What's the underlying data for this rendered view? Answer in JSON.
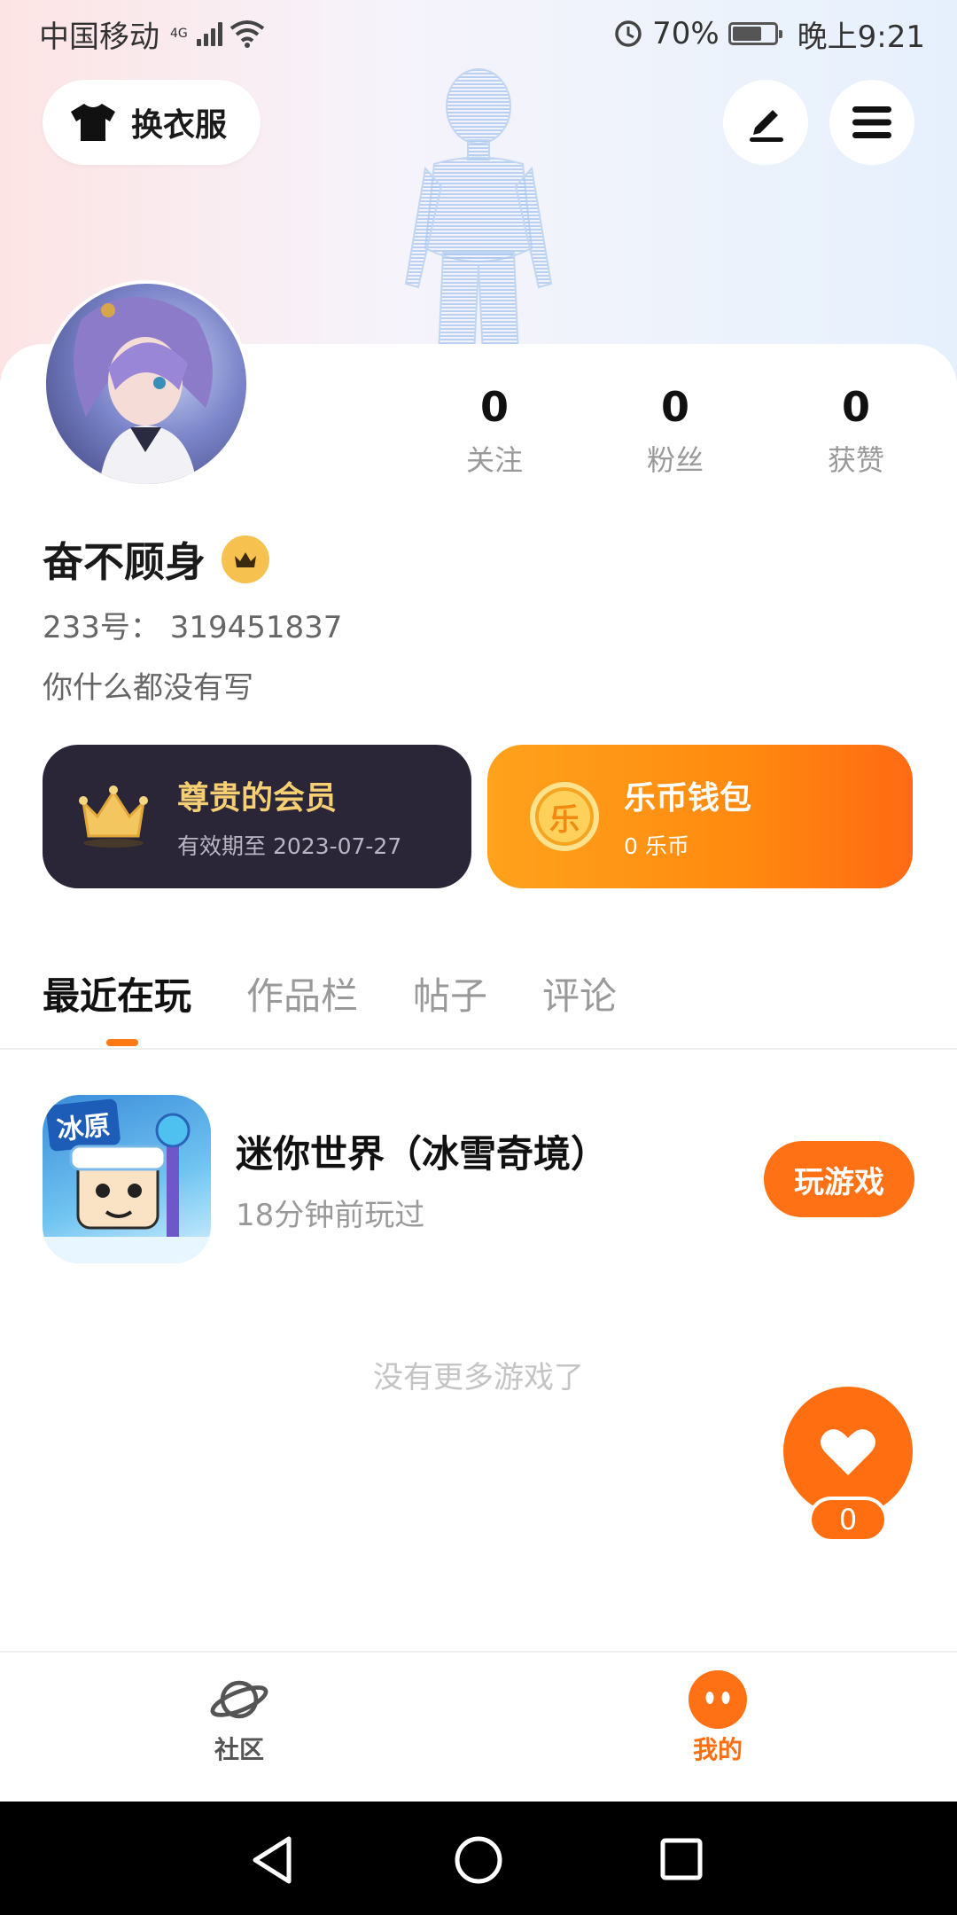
{
  "status_bar": {
    "carrier": "中国移动",
    "network": "4G",
    "battery": "70%",
    "time": "晚上9:21"
  },
  "header": {
    "outfit_button_label": "换衣服",
    "edit_icon": "pencil-icon",
    "menu_icon": "hamburger-menu-icon"
  },
  "profile": {
    "stats": [
      {
        "value": "0",
        "label": "关注"
      },
      {
        "value": "0",
        "label": "粉丝"
      },
      {
        "value": "0",
        "label": "获赞"
      }
    ],
    "username": "奋不顾身",
    "uid": "233号：  319451837",
    "bio": "你什么都没有写"
  },
  "member_card": {
    "title": "尊贵的会员",
    "subtitle": "有效期至 2023-07-27"
  },
  "wallet_card": {
    "title": "乐币钱包",
    "subtitle": "0 乐币",
    "coin_glyph": "乐"
  },
  "tabs": [
    "最近在玩",
    "作品栏",
    "帖子",
    "评论"
  ],
  "recent_game": {
    "icon_text": "冰原",
    "title": "迷你世界（冰雪奇境）",
    "last_played": "18分钟前玩过",
    "play_button": "玩游戏"
  },
  "empty_hint": "没有更多游戏了",
  "like_fab": {
    "count": "0"
  },
  "bottom_nav": [
    {
      "label": "社区",
      "icon": "planet-icon"
    },
    {
      "label": "我的",
      "icon": "smiley-face-icon"
    }
  ],
  "colors": {
    "accent": "#ff7114",
    "member_card_bg": "#2a2638",
    "member_title": "#f7cf73"
  }
}
